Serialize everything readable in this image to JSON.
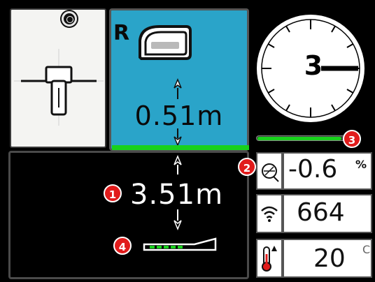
{
  "locator": {
    "target_icon": "target-icon",
    "locator_icon": "locator-antenna-icon"
  },
  "depth_panel": {
    "roll_label": "R",
    "sonde_icon": "sonde-icon",
    "sonde_depth": "0.51m",
    "background_color": "#2aa4c9",
    "status_bar_color": "#18d11c"
  },
  "surface_panel": {
    "ground_depth": "3.51m",
    "sonde_line_icon": "sonde-pitch-line-icon"
  },
  "roll_dial": {
    "value": "3",
    "pointer_position": "3 o'clock"
  },
  "signal_bar": {
    "fill_fraction": 0.95,
    "color": "#18d11c"
  },
  "pitch": {
    "icon": "pitch-gauge-icon",
    "value": "-0.6",
    "unit": "%"
  },
  "signal_strength": {
    "icon": "wifi-icon",
    "value": "664"
  },
  "temperature": {
    "icon": "thermometer-icon",
    "value": "20",
    "unit": "C"
  },
  "callouts": [
    {
      "number": "1",
      "target": "ground-depth"
    },
    {
      "number": "2",
      "target": "pitch-readout"
    },
    {
      "number": "3",
      "target": "signal-bar"
    },
    {
      "number": "4",
      "target": "sonde-line"
    }
  ]
}
